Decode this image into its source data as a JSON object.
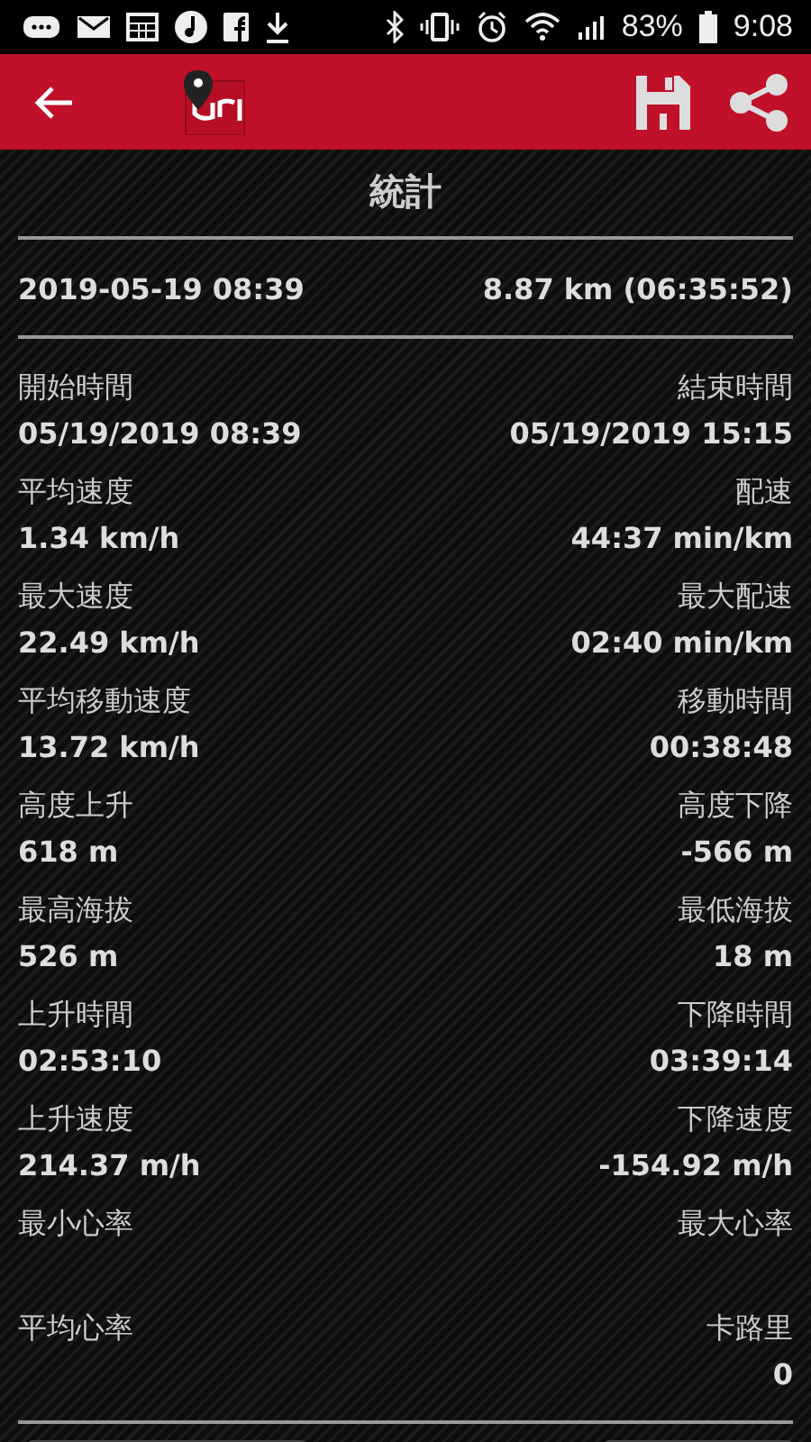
{
  "status_bar": {
    "battery": "83%",
    "time": "9:08"
  },
  "toolbar": {
    "title": "統計"
  },
  "summary": {
    "start": "2019-05-19 08:39",
    "distance": "8.87 km (06:35:52)"
  },
  "stats": [
    {
      "left": {
        "label": "開始時間",
        "value": "05/19/2019 08:39"
      },
      "right": {
        "label": "結束時間",
        "value": "05/19/2019 15:15"
      }
    },
    {
      "left": {
        "label": "平均速度",
        "value": "1.34 km/h"
      },
      "right": {
        "label": "配速",
        "value": "44:37 min/km"
      }
    },
    {
      "left": {
        "label": "最大速度",
        "value": "22.49 km/h"
      },
      "right": {
        "label": "最大配速",
        "value": "02:40 min/km"
      }
    },
    {
      "left": {
        "label": "平均移動速度",
        "value": "13.72 km/h"
      },
      "right": {
        "label": "移動時間",
        "value": "00:38:48"
      }
    },
    {
      "left": {
        "label": "高度上升",
        "value": "618 m"
      },
      "right": {
        "label": "高度下降",
        "value": "-566 m"
      }
    },
    {
      "left": {
        "label": "最高海拔",
        "value": "526 m"
      },
      "right": {
        "label": "最低海拔",
        "value": "18 m"
      }
    },
    {
      "left": {
        "label": "上升時間",
        "value": "02:53:10"
      },
      "right": {
        "label": "下降時間",
        "value": "03:39:14"
      }
    },
    {
      "left": {
        "label": "上升速度",
        "value": "214.37 m/h"
      },
      "right": {
        "label": "下降速度",
        "value": "-154.92 m/h"
      }
    },
    {
      "left": {
        "label": "最小心率"
      },
      "right": {
        "label": "最大心率"
      }
    },
    {
      "left": {
        "label": "平均心率"
      },
      "right": {
        "label": "卡路里",
        "value": "0"
      }
    }
  ]
}
